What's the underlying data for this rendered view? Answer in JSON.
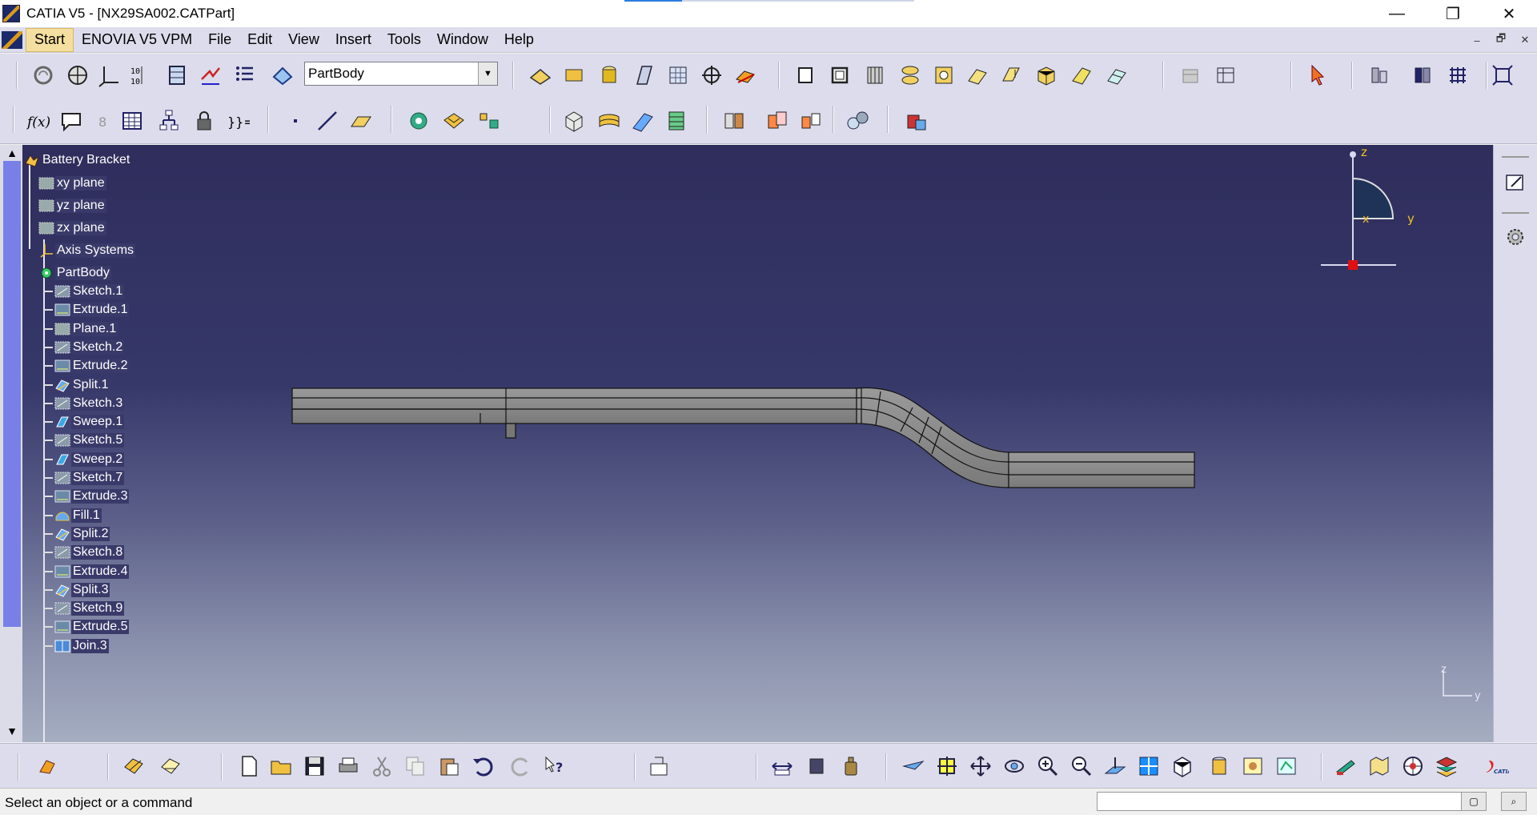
{
  "window": {
    "title": "CATIA V5 - [NX29SA002.CATPart]",
    "minimize_glyph": "—",
    "restore_glyph": "❐",
    "close_glyph": "✕"
  },
  "menubar": {
    "items": [
      {
        "label": "Start"
      },
      {
        "label": "ENOVIA V5 VPM"
      },
      {
        "label": "File"
      },
      {
        "label": "Edit"
      },
      {
        "label": "View"
      },
      {
        "label": "Insert"
      },
      {
        "label": "Tools"
      },
      {
        "label": "Window"
      },
      {
        "label": "Help"
      }
    ],
    "doc_minimize": "–",
    "doc_restore": "🗗",
    "doc_close": "✕"
  },
  "toolbar": {
    "workbench_select": "PartBody",
    "select_arrow": "▼"
  },
  "tree": {
    "scroll_up": "▲",
    "scroll_down": "▼",
    "root": "Battery Bracket",
    "planes": [
      "xy plane",
      "yz plane",
      "zx plane"
    ],
    "axis_systems": "Axis Systems",
    "body": "PartBody",
    "features": [
      {
        "label": "Sketch.1",
        "icon": "sketch-icon"
      },
      {
        "label": "Extrude.1",
        "icon": "extrude-icon"
      },
      {
        "label": "Plane.1",
        "icon": "plane-icon"
      },
      {
        "label": "Sketch.2",
        "icon": "sketch-icon"
      },
      {
        "label": "Extrude.2",
        "icon": "extrude-icon"
      },
      {
        "label": "Split.1",
        "icon": "split-icon"
      },
      {
        "label": "Sketch.3",
        "icon": "sketch-icon"
      },
      {
        "label": "Sweep.1",
        "icon": "sweep-icon"
      },
      {
        "label": "Sketch.5",
        "icon": "sketch-icon"
      },
      {
        "label": "Sweep.2",
        "icon": "sweep-icon"
      },
      {
        "label": "Sketch.7",
        "icon": "sketch-icon"
      },
      {
        "label": "Extrude.3",
        "icon": "extrude-icon"
      },
      {
        "label": "Fill.1",
        "icon": "fill-icon"
      },
      {
        "label": "Split.2",
        "icon": "split-icon"
      },
      {
        "label": "Sketch.8",
        "icon": "sketch-icon"
      },
      {
        "label": "Extrude.4",
        "icon": "extrude-icon"
      },
      {
        "label": "Split.3",
        "icon": "split-icon"
      },
      {
        "label": "Sketch.9",
        "icon": "sketch-icon"
      },
      {
        "label": "Extrude.5",
        "icon": "extrude-icon"
      },
      {
        "label": "Join.3",
        "icon": "join-icon"
      }
    ]
  },
  "compass": {
    "z": "z",
    "x": "x",
    "y": "y"
  },
  "mini_axes": {
    "z": "z",
    "y": "y"
  },
  "status": {
    "text": "Select an object or a command"
  },
  "colors": {
    "accent": "#2a7de1",
    "menu_bg": "#dcdcec",
    "viewport_top": "#2f2d5c",
    "viewport_bottom": "#a5adc1",
    "part_fill": "#8a8a8a"
  }
}
